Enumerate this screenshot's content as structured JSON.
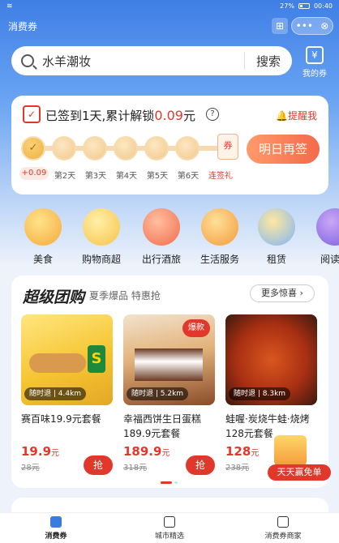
{
  "status_bar": {
    "battery": "27%",
    "time": "00:40"
  },
  "app": {
    "title": "消费券"
  },
  "search": {
    "placeholder": "水羊潮妆",
    "button": "搜索"
  },
  "my_coupons": {
    "label": "我的券"
  },
  "checkin": {
    "text_prefix": "已签到1天,累计解锁",
    "amount": "0.09",
    "unit": "元",
    "remind": "提醒我",
    "reward_today": "+0.09",
    "days": [
      "第2天",
      "第3天",
      "第4天",
      "第5天",
      "第6天"
    ],
    "streak_gift": "连签礼",
    "gift_badge": "券",
    "tomorrow_button": "明日再签"
  },
  "categories": [
    {
      "label": "美食"
    },
    {
      "label": "购物商超"
    },
    {
      "label": "出行酒旅"
    },
    {
      "label": "生活服务"
    },
    {
      "label": "租赁"
    },
    {
      "label": "阅读娱"
    }
  ],
  "group_buy": {
    "title": "超级团购",
    "subtitle": "夏季爆品 特惠抢",
    "more": "更多惊喜",
    "items": [
      {
        "tag": "随时退 | 4.4km",
        "name": "赛百味19.9元套餐",
        "price": "19.9",
        "unit": "元",
        "old": "28元",
        "grab": "抢"
      },
      {
        "tag": "随时退 | 5.2km",
        "name": "幸福西饼生日蛋糕189.9元套餐",
        "price": "189.9",
        "unit": "元",
        "old": "318元",
        "grab": "抢",
        "badge": "爆款"
      },
      {
        "tag": "随时退 | 8.3km",
        "name": "蛙喔·炭烧牛蛙·烧烤128元套餐",
        "price": "128",
        "unit": "元",
        "old": "238元"
      }
    ]
  },
  "freebie": {
    "label": "天天赢免单"
  },
  "tabbar": [
    {
      "label": "消费券",
      "active": true
    },
    {
      "label": "城市精选"
    },
    {
      "label": "消费券商家"
    }
  ],
  "colors": {
    "accent": "#e2382b",
    "brand_blue": "#3f7fe6"
  }
}
